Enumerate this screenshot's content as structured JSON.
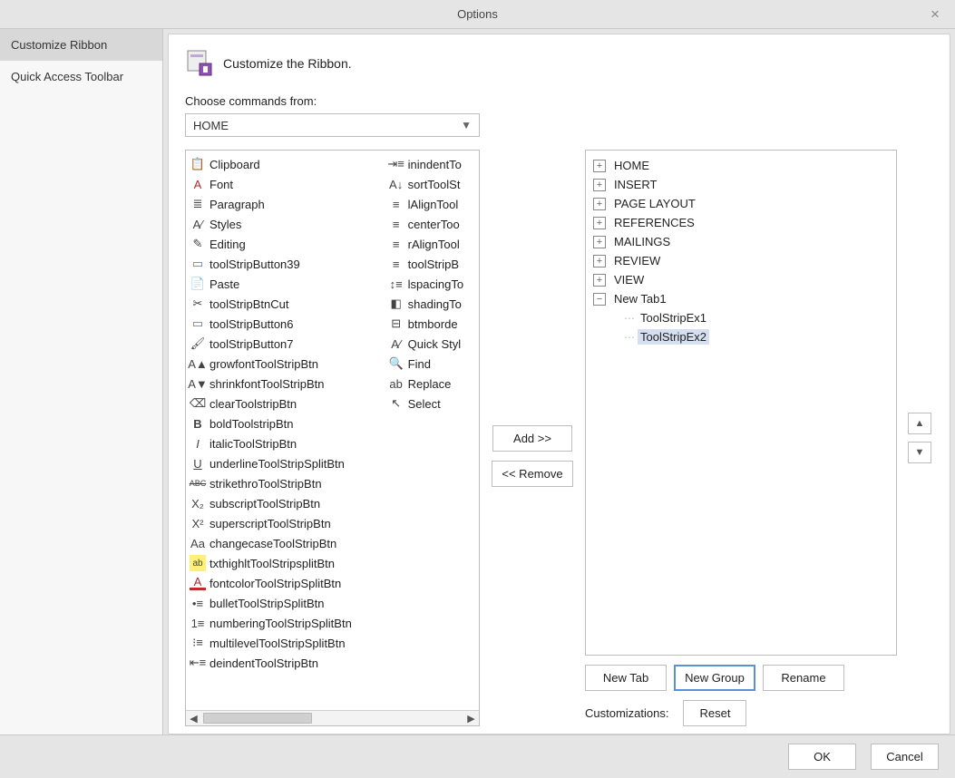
{
  "window": {
    "title": "Options",
    "close_glyph": "×"
  },
  "sidebar": {
    "items": [
      {
        "label": "Customize Ribbon",
        "selected": true
      },
      {
        "label": "Quick Access Toolbar",
        "selected": false
      }
    ]
  },
  "page": {
    "heading": "Customize the Ribbon.",
    "choose_commands_label": "Choose commands from:",
    "dropdown_value": "HOME",
    "commands_col1": [
      {
        "icon": "clipboard-icon",
        "label": "Clipboard"
      },
      {
        "icon": "font-letter-icon",
        "label": "Font"
      },
      {
        "icon": "paragraph-icon",
        "label": "Paragraph"
      },
      {
        "icon": "styles-icon",
        "label": "Styles"
      },
      {
        "icon": "editing-icon",
        "label": "Editing"
      },
      {
        "icon": "button-icon",
        "label": "toolStripButton39"
      },
      {
        "icon": "paste-icon",
        "label": "Paste"
      },
      {
        "icon": "scissors-icon",
        "label": "toolStripBtnCut"
      },
      {
        "icon": "button-icon",
        "label": "toolStripButton6"
      },
      {
        "icon": "brush-icon",
        "label": "toolStripButton7"
      },
      {
        "icon": "grow-font-icon",
        "label": "growfontToolStripBtn"
      },
      {
        "icon": "shrink-font-icon",
        "label": "shrinkfontToolStripBtn"
      },
      {
        "icon": "clear-icon",
        "label": "clearToolstripBtn"
      },
      {
        "icon": "bold-icon",
        "label": "boldToolstripBtn"
      },
      {
        "icon": "italic-icon",
        "label": "italicToolStripBtn"
      },
      {
        "icon": "underline-icon",
        "label": "underlineToolStripSplitBtn"
      },
      {
        "icon": "strike-icon",
        "label": "strikethroToolStripBtn"
      },
      {
        "icon": "subscript-icon",
        "label": "subscriptToolStripBtn"
      },
      {
        "icon": "superscript-icon",
        "label": "superscriptToolStripBtn"
      },
      {
        "icon": "changecase-icon",
        "label": "changecaseToolStripBtn"
      },
      {
        "icon": "highlight-icon",
        "label": "txthighltToolStripsplitBtn"
      },
      {
        "icon": "fontcolor-icon",
        "label": "fontcolorToolStripSplitBtn"
      },
      {
        "icon": "bullet-icon",
        "label": "bulletToolStripSplitBtn"
      },
      {
        "icon": "numbering-icon",
        "label": "numberingToolStripSplitBtn"
      },
      {
        "icon": "multilevel-icon",
        "label": "multilevelToolStripSplitBtn"
      },
      {
        "icon": "deindent-icon",
        "label": "deindentToolStripBtn"
      }
    ],
    "commands_col2": [
      {
        "icon": "inindent-icon",
        "label": "inindentTo"
      },
      {
        "icon": "sort-icon",
        "label": "sortToolSt"
      },
      {
        "icon": "lalign-icon",
        "label": "lAlignTool"
      },
      {
        "icon": "center-icon",
        "label": "centerToo"
      },
      {
        "icon": "ralign-icon",
        "label": "rAlignTool"
      },
      {
        "icon": "toolstrip-icon",
        "label": "toolStripB"
      },
      {
        "icon": "lspacing-icon",
        "label": "lspacingTo"
      },
      {
        "icon": "shading-icon",
        "label": "shadingTo"
      },
      {
        "icon": "border-icon",
        "label": "btmborde"
      },
      {
        "icon": "quickstyle-icon",
        "label": "Quick Styl"
      },
      {
        "icon": "find-icon",
        "label": "Find"
      },
      {
        "icon": "replace-icon",
        "label": "Replace"
      },
      {
        "icon": "select-icon",
        "label": "Select"
      }
    ],
    "transfer": {
      "add": "Add >>",
      "remove": "<< Remove"
    },
    "tree": {
      "tabs": [
        {
          "label": "HOME",
          "expanded": false
        },
        {
          "label": "INSERT",
          "expanded": false
        },
        {
          "label": "PAGE LAYOUT",
          "expanded": false
        },
        {
          "label": "REFERENCES",
          "expanded": false
        },
        {
          "label": "MAILINGS",
          "expanded": false
        },
        {
          "label": "REVIEW",
          "expanded": false
        },
        {
          "label": "VIEW",
          "expanded": false
        }
      ],
      "custom_tab": {
        "label": "New Tab1",
        "expanded": true,
        "groups": [
          {
            "label": "ToolStripEx1",
            "selected": false
          },
          {
            "label": "ToolStripEx2",
            "selected": true
          }
        ]
      }
    },
    "tree_buttons": {
      "new_tab": "New Tab",
      "new_group": "New Group",
      "rename": "Rename"
    },
    "customizations_label": "Customizations:",
    "reset": "Reset"
  },
  "footer": {
    "ok": "OK",
    "cancel": "Cancel"
  },
  "glyphs": {
    "chev_down": "▼",
    "tri_left": "◀",
    "tri_right": "▶",
    "tri_up": "▲",
    "tri_down": "▼",
    "plus": "+",
    "minus": "−"
  },
  "icon_glyphs": {
    "clipboard-icon": "📋",
    "font-letter-icon": "A",
    "paragraph-icon": "≣",
    "styles-icon": "A⁄",
    "editing-icon": "✎",
    "button-icon": "▭",
    "paste-icon": "📄",
    "scissors-icon": "✂",
    "brush-icon": "🖌",
    "grow-font-icon": "A▲",
    "shrink-font-icon": "A▼",
    "clear-icon": "⌫",
    "bold-icon": "B",
    "italic-icon": "I",
    "underline-icon": "U",
    "strike-icon": "ABC",
    "subscript-icon": "X₂",
    "superscript-icon": "X²",
    "changecase-icon": "Aa",
    "highlight-icon": "ab",
    "fontcolor-icon": "A",
    "bullet-icon": "•≡",
    "numbering-icon": "1≡",
    "multilevel-icon": "⁝≡",
    "deindent-icon": "⇤≡",
    "inindent-icon": "⇥≡",
    "sort-icon": "A↓",
    "lalign-icon": "≡",
    "center-icon": "≡",
    "ralign-icon": "≡",
    "toolstrip-icon": "≡",
    "lspacing-icon": "↕≡",
    "shading-icon": "◧",
    "border-icon": "⊟",
    "quickstyle-icon": "A⁄",
    "find-icon": "🔍",
    "replace-icon": "ab",
    "select-icon": "↖"
  }
}
